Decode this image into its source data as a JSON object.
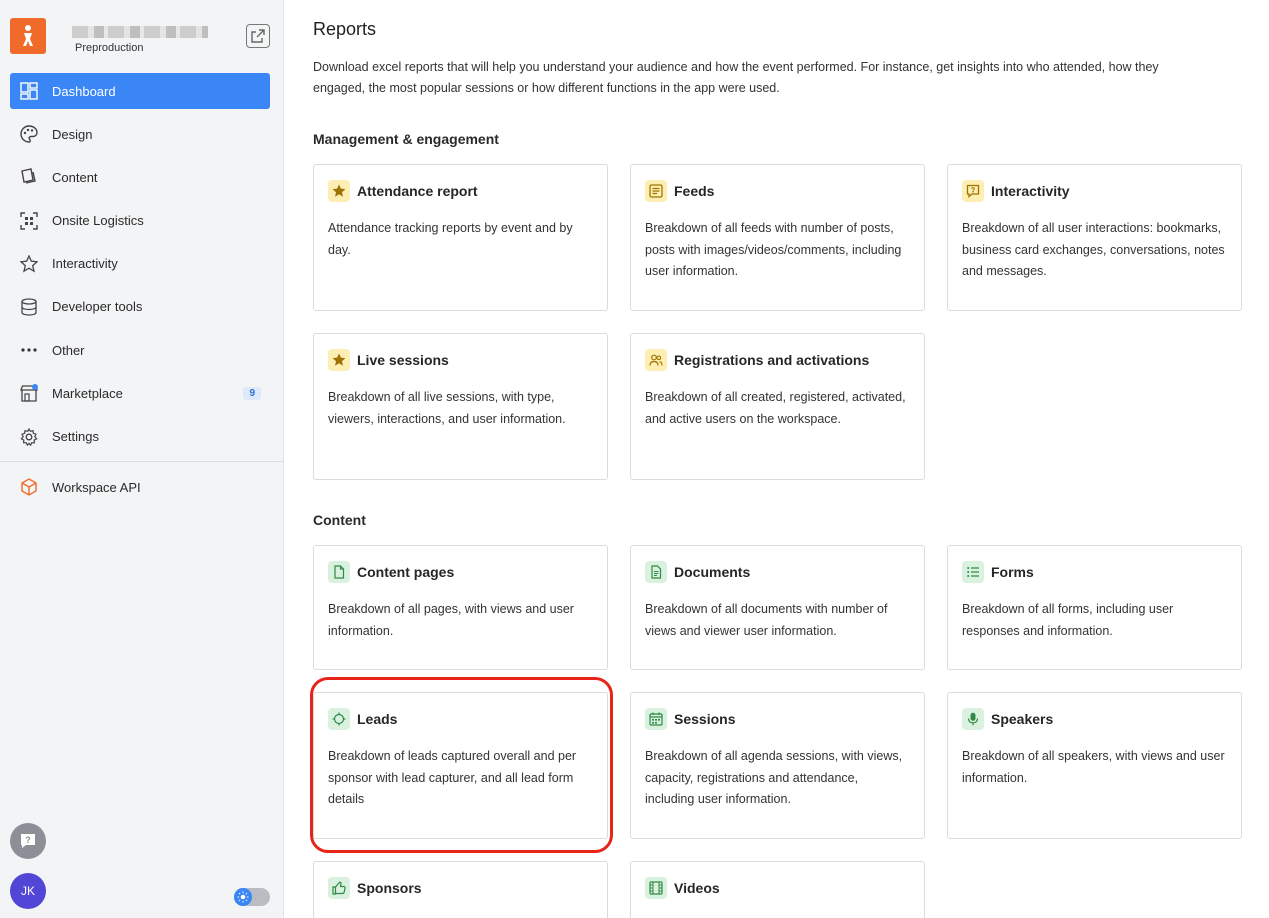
{
  "workspace": {
    "subtitle": "Preproduction",
    "brand_color": "#f06a2a"
  },
  "sidebar": {
    "items": [
      {
        "label": "Dashboard",
        "icon": "dashboard-icon",
        "active": true
      },
      {
        "label": "Design",
        "icon": "palette-icon"
      },
      {
        "label": "Content",
        "icon": "content-icon"
      },
      {
        "label": "Onsite Logistics",
        "icon": "qr-scan-icon"
      },
      {
        "label": "Interactivity",
        "icon": "star-outline-icon"
      },
      {
        "label": "Developer tools",
        "icon": "database-icon"
      },
      {
        "label": "Other",
        "icon": "more-dots-icon"
      },
      {
        "label": "Marketplace",
        "icon": "store-icon",
        "badge": "9"
      },
      {
        "label": "Settings",
        "icon": "gear-icon"
      }
    ],
    "api": {
      "label": "Workspace API",
      "icon": "cube-icon"
    },
    "avatar_initials": "JK",
    "accent_color": "#3a86f7"
  },
  "main": {
    "title": "Reports",
    "description": "Download excel reports that will help you understand your audience and how the event performed. For instance, get insights into who attended, how they engaged, the most popular sessions or how different functions in the app were used.",
    "sections": [
      {
        "title": "Management & engagement",
        "cards": [
          {
            "title": "Attendance report",
            "desc": "Attendance tracking reports by event and by day.",
            "icon": "star-icon"
          },
          {
            "title": "Feeds",
            "desc": "Breakdown of all feeds with number of posts, posts with images/videos/comments, including user information.",
            "icon": "feed-icon"
          },
          {
            "title": "Interactivity",
            "desc": "Breakdown of all user interactions: bookmarks, business card exchanges, conversations, notes and messages.",
            "icon": "chat-icon"
          },
          {
            "title": "Live sessions",
            "desc": "Breakdown of all live sessions, with type, viewers, interactions, and user information.",
            "icon": "star-icon"
          },
          {
            "title": "Registrations and activations",
            "desc": "Breakdown of all created, registered, activated, and active users on the workspace.",
            "icon": "users-icon"
          }
        ]
      },
      {
        "title": "Content",
        "cards": [
          {
            "title": "Content pages",
            "desc": "Breakdown of all pages, with views and user information.",
            "icon": "page-icon"
          },
          {
            "title": "Documents",
            "desc": "Breakdown of all documents with number of views and viewer user information.",
            "icon": "document-icon"
          },
          {
            "title": "Forms",
            "desc": "Breakdown of all forms, including user responses and information.",
            "icon": "list-icon"
          },
          {
            "title": "Leads",
            "desc": "Breakdown of leads captured overall and per sponsor with lead capturer, and all lead form details",
            "icon": "crosshair-icon"
          },
          {
            "title": "Sessions",
            "desc": "Breakdown of all agenda sessions, with views, capacity, registrations and attendance, including user information.",
            "icon": "calendar-icon"
          },
          {
            "title": "Speakers",
            "desc": "Breakdown of all speakers, with views and user information.",
            "icon": "microphone-icon"
          },
          {
            "title": "Sponsors",
            "desc": "",
            "icon": "thumbs-up-icon"
          },
          {
            "title": "Videos",
            "desc": "",
            "icon": "film-icon"
          }
        ]
      }
    ]
  },
  "colors": {
    "highlight": "#e8231a",
    "yellow_icon_bg": "#fdeeb3",
    "green_icon_bg": "#d9f1de"
  }
}
